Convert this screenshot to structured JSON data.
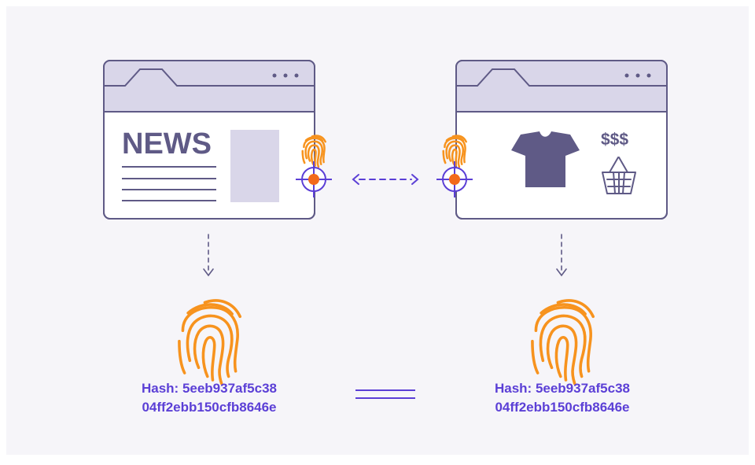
{
  "left_window": {
    "headline": "NEWS"
  },
  "right_window": {
    "price_label": "$$$"
  },
  "left_hash": {
    "line1": "Hash: 5eeb937af5c38",
    "line2": "04ff2ebb150cfb8646e"
  },
  "right_hash": {
    "line1": "Hash: 5eeb937af5c38",
    "line2": "04ff2ebb150cfb8646e"
  },
  "colors": {
    "background": "#f6f5f9",
    "window_stroke": "#5f5a86",
    "window_bar": "#d9d6e9",
    "accent_purple": "#5b3fd6",
    "fingerprint_orange": "#f7931e",
    "target_dot": "#f26a1b",
    "text_dark": "#5f5a86"
  },
  "icons": [
    "browser-window-icon",
    "fingerprint-icon",
    "crosshair-target-icon",
    "tshirt-icon",
    "shopping-basket-icon",
    "dashed-double-arrow-icon",
    "down-arrow-icon",
    "equals-sign-icon"
  ]
}
